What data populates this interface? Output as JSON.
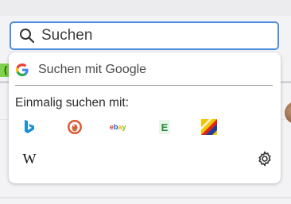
{
  "search": {
    "placeholder": "Suchen",
    "value": ""
  },
  "dropdown": {
    "primary_engine_label": "Suchen mit Google",
    "heading": "Einmalig suchen mit:",
    "engines": [
      {
        "name": "Bing",
        "icon": "bing-icon"
      },
      {
        "name": "DuckDuckGo",
        "icon": "duckduckgo-icon"
      },
      {
        "name": "eBay",
        "icon": "ebay-icon"
      },
      {
        "name": "Ecosia",
        "icon": "ecosia-icon"
      },
      {
        "name": "LEO",
        "icon": "leo-icon"
      },
      {
        "name": "Wikipedia",
        "icon": "wikipedia-icon"
      }
    ],
    "settings_icon": "gear-icon"
  },
  "icons": {
    "search": "search-icon",
    "google": "google-icon",
    "ebay_text": "ebay",
    "ecosia_letter": "E",
    "wikipedia_letter": "W"
  },
  "colors": {
    "focus_border": "#4d8fdf",
    "bing": "#1a8fd6",
    "duckduckgo": "#de5833",
    "ecosia": "#2a8a3a"
  }
}
